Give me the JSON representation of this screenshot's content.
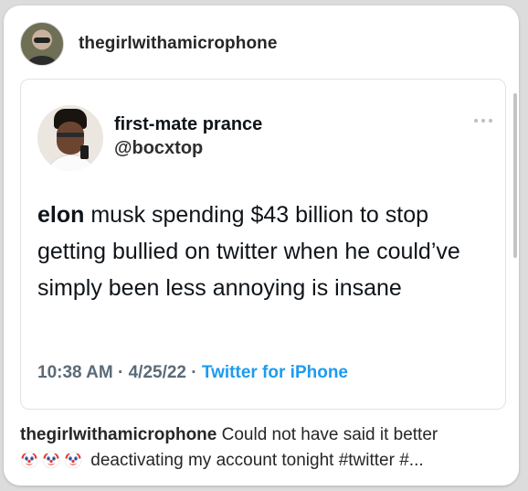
{
  "post": {
    "username": "thegirlwithamicrophone"
  },
  "tweet": {
    "display_name": "first-mate prance",
    "handle": "@bocxtop",
    "text_bold": "elon",
    "text_rest": " musk spending $43 billion to stop getting bullied on twitter when he could’ve simply been less annoying is insane",
    "time": "10:38 AM",
    "date": "4/25/22",
    "source": "Twitter for iPhone",
    "separator": "·"
  },
  "caption": {
    "username": "thegirlwithamicrophone",
    "text_line1": " Could not have said it better",
    "text_line2": " deactivating my account tonight #twitter #...",
    "emoji_names": [
      "clown-face-icon",
      "clown-face-icon",
      "clown-face-icon"
    ]
  },
  "colors": {
    "link_blue": "#1d9bf0",
    "meta_gray": "#5b6b78",
    "text_dark": "#0f1419"
  }
}
